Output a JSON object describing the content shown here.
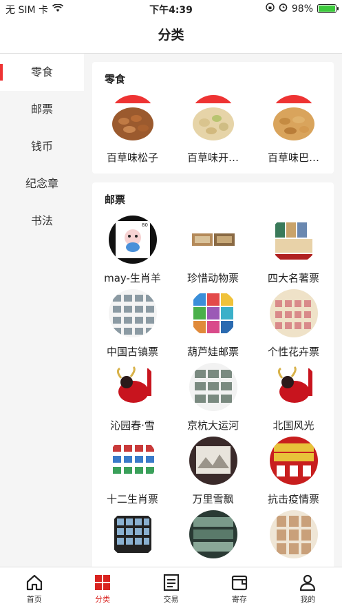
{
  "status_bar": {
    "carrier": "无 SIM 卡",
    "time": "下午4:39",
    "battery": "98%"
  },
  "nav": {
    "title": "分类"
  },
  "sidebar": {
    "items": [
      {
        "label": "零食",
        "active": true
      },
      {
        "label": "邮票",
        "active": false
      },
      {
        "label": "钱币",
        "active": false
      },
      {
        "label": "纪念章",
        "active": false
      },
      {
        "label": "书法",
        "active": false
      }
    ]
  },
  "sections": [
    {
      "title": "零食",
      "items": [
        {
          "label": "百草味松子",
          "icon": "nuts-image"
        },
        {
          "label": "百草味开…",
          "icon": "pistachio-image"
        },
        {
          "label": "百草味巴…",
          "icon": "almond-image"
        }
      ]
    },
    {
      "title": "邮票",
      "items": [
        {
          "label": "may-生肖羊",
          "icon": "sheep-stamp-image"
        },
        {
          "label": "珍惜动物票",
          "icon": "animal-stamp-image"
        },
        {
          "label": "四大名著票",
          "icon": "classics-stamp-image"
        },
        {
          "label": "中国古镇票",
          "icon": "town-stamp-image"
        },
        {
          "label": "葫芦娃邮票",
          "icon": "calabash-stamp-image"
        },
        {
          "label": "个性花卉票",
          "icon": "flower-stamp-image"
        },
        {
          "label": "沁园春·雪",
          "icon": "ox-stamp-image"
        },
        {
          "label": "京杭大运河",
          "icon": "canal-stamp-image"
        },
        {
          "label": "北国风光",
          "icon": "ox-stamp-image"
        },
        {
          "label": "十二生肖票",
          "icon": "zodiac-stamp-image"
        },
        {
          "label": "万里雪飘",
          "icon": "snow-stamp-image"
        },
        {
          "label": "抗击疫情票",
          "icon": "epidemic-stamp-image"
        },
        {
          "label": "",
          "icon": "stamp-sheet-image"
        },
        {
          "label": "",
          "icon": "mountain-stamp-image"
        },
        {
          "label": "",
          "icon": "figure-stamp-image"
        }
      ]
    }
  ],
  "tabbar": {
    "tabs": [
      {
        "label": "首页",
        "icon": "home-icon",
        "active": false
      },
      {
        "label": "分类",
        "icon": "category-icon",
        "active": true
      },
      {
        "label": "交易",
        "icon": "trade-icon",
        "active": false
      },
      {
        "label": "寄存",
        "icon": "wallet-icon",
        "active": false
      },
      {
        "label": "我的",
        "icon": "user-icon",
        "active": false
      }
    ]
  },
  "colors": {
    "accent": "#d9231f",
    "active_bar": "#ee3333"
  }
}
